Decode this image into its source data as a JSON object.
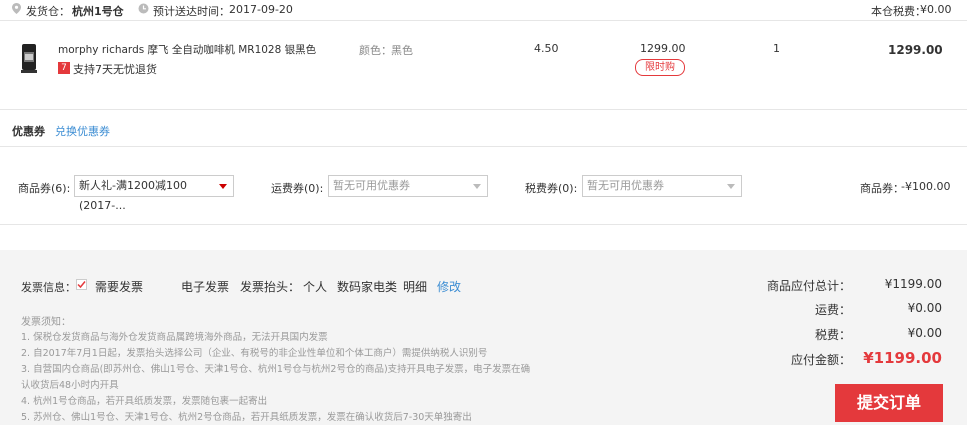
{
  "header": {
    "warehouse_label": "发货仓：",
    "warehouse_value": "杭州1号仓",
    "delivery_label": "预计送达时间：",
    "delivery_date": "2017-09-20",
    "tax_label": "本仓税费：",
    "tax_value": "¥0.00"
  },
  "product": {
    "name": "morphy richards 摩飞 全自动咖啡机 MR1028 银黑色",
    "return_badge": "7",
    "return_text": "支持7天无忧退货",
    "color_label": "颜色：",
    "color_value": "黑色",
    "rate": "4.50",
    "price": "1299.00",
    "promo_tag": "限时购",
    "quantity": "1",
    "subtotal": "1299.00"
  },
  "coupons": {
    "title": "优惠券",
    "exchange_link": "兑换优惠券",
    "goods_label": "商品券(6):",
    "goods_selected": "新人礼-满1200减100 (2017-...",
    "shipping_label": "运费券(0):",
    "shipping_placeholder": "暂无可用优惠券",
    "tax_label": "税费券(0):",
    "tax_placeholder": "暂无可用优惠券",
    "discount_label": "商品券：",
    "discount_value": "-¥100.00"
  },
  "invoice": {
    "info_label": "发票信息：",
    "need_invoice": "需要发票",
    "type": "电子发票",
    "title_label": "发票抬头：",
    "title_value": "个人",
    "category_label": "数码家电类",
    "detail": "明细",
    "edit_link": "修改",
    "notes_title": "发票须知：",
    "notes": [
      "1. 保税仓发货商品与海外仓发货商品属跨境海外商品，无法开具国内发票",
      "2. 自2017年7月1日起，发票抬头选择公司（企业、有税号的非企业性单位和个体工商户）需提供纳税人识别号",
      "3. 自营国内仓商品(即苏州仓、佛山1号仓、天津1号仓、杭州1号仓与杭州2号仓的商品)支持开具电子发票，电子发票在确",
      "认收货后48小时内开具",
      "4. 杭州1号仓商品，若开具纸质发票，发票随包裹一起寄出",
      "5. 苏州仓、佛山1号仓、天津1号仓、杭州2号仓商品，若开具纸质发票，发票在确认收货后7-30天单独寄出"
    ]
  },
  "summary": {
    "goods_total_label": "商品应付总计：",
    "goods_total_value": "¥1199.00",
    "shipping_label": "运费：",
    "shipping_value": "¥0.00",
    "tax_label": "税费：",
    "tax_value": "¥0.00",
    "payable_label": "应付金额：",
    "payable_value": "¥1199.00"
  },
  "submit_label": "提交订单",
  "colors": {
    "accent": "#e4393c",
    "link": "#3c8dd3"
  }
}
